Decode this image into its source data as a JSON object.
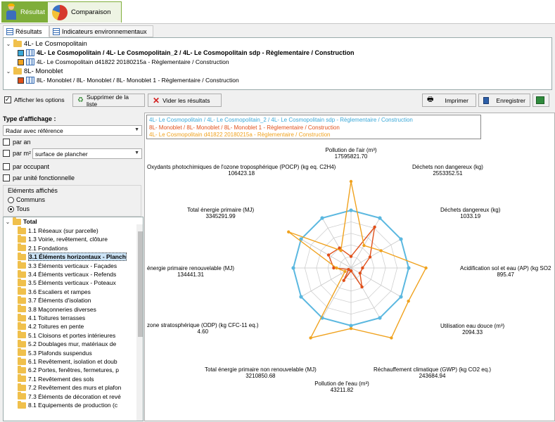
{
  "top_tabs": {
    "resultat": "Résultat",
    "comparaison": "Comparaison"
  },
  "sub_tabs": {
    "resultats": "Résultats",
    "indicateurs": "Indicateurs environnementaux"
  },
  "list": {
    "group1": "4L- Le Cosmopolitain",
    "group1_item1": "4L- Le Cosmopolitain / 4L- Le Cosmopolitain_2 / 4L- Le Cosmopolitain sdp - Règlementaire / Construction",
    "group1_item2": "4L- Le Cosmopolitain d41822 20180215a - Règlementaire / Construction",
    "group2": "8L- Monoblet",
    "group2_item1": "8L- Monoblet / 8L- Monoblet / 8L- Monoblet 1 - Règlementaire / Construction"
  },
  "toolbar": {
    "afficher_options": "Afficher les options",
    "supprimer": "Supprimer de la liste",
    "vider": "Vider les résultats",
    "imprimer": "Imprimer",
    "enregistrer": "Enregistrer"
  },
  "options": {
    "type_label": "Type d'affichage :",
    "type_value": "Radar avec référence",
    "par_an": "par an",
    "par_m2": "par m²",
    "surface_value": "surface de plancher",
    "par_occupant": "par occupant",
    "par_unite": "par unité fonctionnelle",
    "elements_affiches": "Eléments affichés",
    "communs": "Communs",
    "tous": "Tous"
  },
  "tree": {
    "root": "Total",
    "items": [
      "1.1 Réseaux (sur parcelle)",
      "1.3 Voirie, revêtement, clôture",
      "2.1 Fondations",
      "3.1 Éléments horizontaux - Planch",
      "3.3 Éléments verticaux - Façades",
      "3.4 Éléments verticaux - Refends",
      "3.5 Éléments verticaux - Poteaux",
      "3.6 Escaliers et rampes",
      "3.7 Éléments d'isolation",
      "3.8 Maçonneries diverses",
      "4.1 Toitures terrasses",
      "4.2 Toitures en pente",
      "5.1 Cloisons et portes intérieures",
      "5.2 Doublages mur, matériaux de",
      "5.3 Plafonds suspendus",
      "6.1 Revêtement, isolation et doub",
      "6.2 Portes, fenêtres, fermetures, p",
      "7.1 Revêtement des sols",
      "7.2 Revêtement des murs et plafon",
      "7.3 Éléments de décoration et revé",
      "8.1 Equipements de production (c"
    ],
    "selected_index": 3
  },
  "colors": {
    "blue": "#5bb8e0",
    "orange": "#f0a21e",
    "red": "#e0501a",
    "legend_blue": "#3aa8d8"
  },
  "chart_data": {
    "type": "radar",
    "legend": [
      {
        "name": "4L- Le Cosmopolitain / 4L- Le Cosmopolitain_2 / 4L- Le Cosmopolitain sdp - Règlementaire / Construction",
        "color": "#3aa8d8"
      },
      {
        "name": "8L- Monoblet / 8L- Monoblet / 8L- Monoblet 1 - Règlementaire / Construction",
        "color": "#e0501a"
      },
      {
        "name": "4L- Le Cosmopolitain d41822 20180215a - Règlementaire / Construction",
        "color": "#f0a21e"
      }
    ],
    "axes": [
      {
        "label": "Pollution de l'air (m³)",
        "value": "17595821.70"
      },
      {
        "label": "Déchets non dangereux (kg)",
        "value": "2553352.51"
      },
      {
        "label": "Déchets dangereux (kg)",
        "value": "1033.19"
      },
      {
        "label": "Acidification sol et eau (AP) (kg SO2",
        "value": "895.47"
      },
      {
        "label": "Utilisation eau douce (m³)",
        "value": "2094.33"
      },
      {
        "label": "Réchauffement climatique (GWP) (kg CO2 eq.)",
        "value": "243684.94"
      },
      {
        "label": "Pollution de l'eau (m³)",
        "value": "43211.82"
      },
      {
        "label": "Total énergie primaire non renouvelable (MJ)",
        "value": "3210850.68"
      },
      {
        "label": "zone stratosphérique (ODP) (kg CFC-11 eq.)",
        "value": "4.60"
      },
      {
        "label": "énergie primaire renouvelable (MJ)",
        "value": "134441.31"
      },
      {
        "label": "Total énergie primaire (MJ)",
        "value": "3345291.99"
      },
      {
        "label": "Oxydants photochimiques de l'ozone troposphérique (POCP) (kg eq. C2H4)",
        "value": "106423.18"
      }
    ],
    "series": [
      {
        "name": "4L- Le Cosmopolitain / 4L- Le Cosmopolitain_2 / 4L- Le Cosmopolitain sdp - Règlementaire / Construction",
        "values": [
          1,
          1,
          1,
          1,
          1,
          1,
          1,
          1,
          1,
          1,
          1,
          1
        ]
      },
      {
        "name": "8L- Monoblet / 8L- Monoblet / 8L- Monoblet 1 - Règlementaire / Construction",
        "values": [
          0.2,
          0.82,
          0.38,
          0.2,
          0.18,
          0.38,
          0.05,
          0.25,
          0.05,
          0.3,
          0.45,
          0.4
        ]
      },
      {
        "name": "4L- Le Cosmopolitain d41822 20180215a - Règlementaire / Construction",
        "values": [
          1.5,
          0.45,
          0.6,
          1.3,
          1.15,
          1.4,
          1.05,
          1.4,
          0.12,
          0.25,
          1.25,
          0.35
        ]
      }
    ],
    "rings": 5,
    "rmax": 1.5
  }
}
